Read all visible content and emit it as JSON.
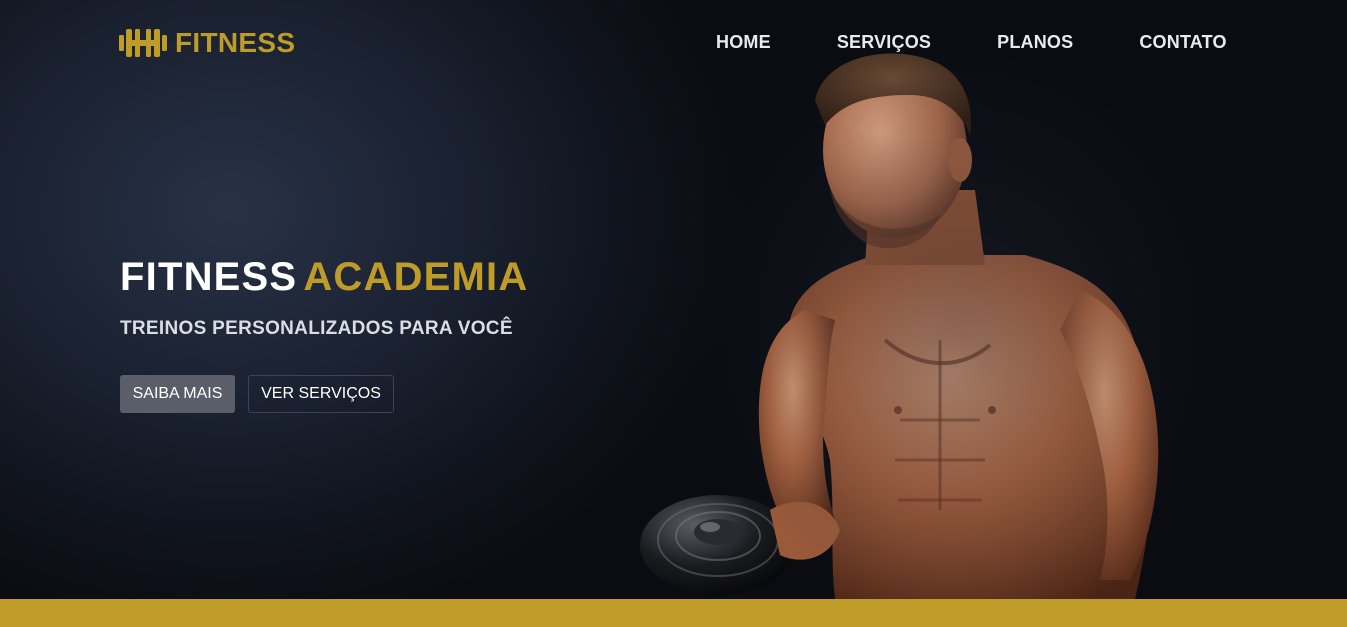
{
  "brand": {
    "name": "FITNESS",
    "icon": "dumbbell-h-icon",
    "color": "#bf9b27"
  },
  "nav": {
    "items": [
      {
        "label": "HOME"
      },
      {
        "label": "SERVIÇOS"
      },
      {
        "label": "PLANOS"
      },
      {
        "label": "CONTATO"
      }
    ]
  },
  "hero": {
    "title_white": "FITNESS",
    "title_gold": "ACADEMIA",
    "subtitle": "TREINOS PERSONALIZADOS PARA VOCÊ",
    "primary_button": "SAIBA MAIS",
    "secondary_button": "VER SERVIÇOS",
    "image": "shirtless-athlete-with-dumbbell"
  },
  "colors": {
    "accent": "#bf9b27",
    "background": "#0b0e16",
    "primary_button_bg": "#5b5e69",
    "text": "#ffffff"
  }
}
